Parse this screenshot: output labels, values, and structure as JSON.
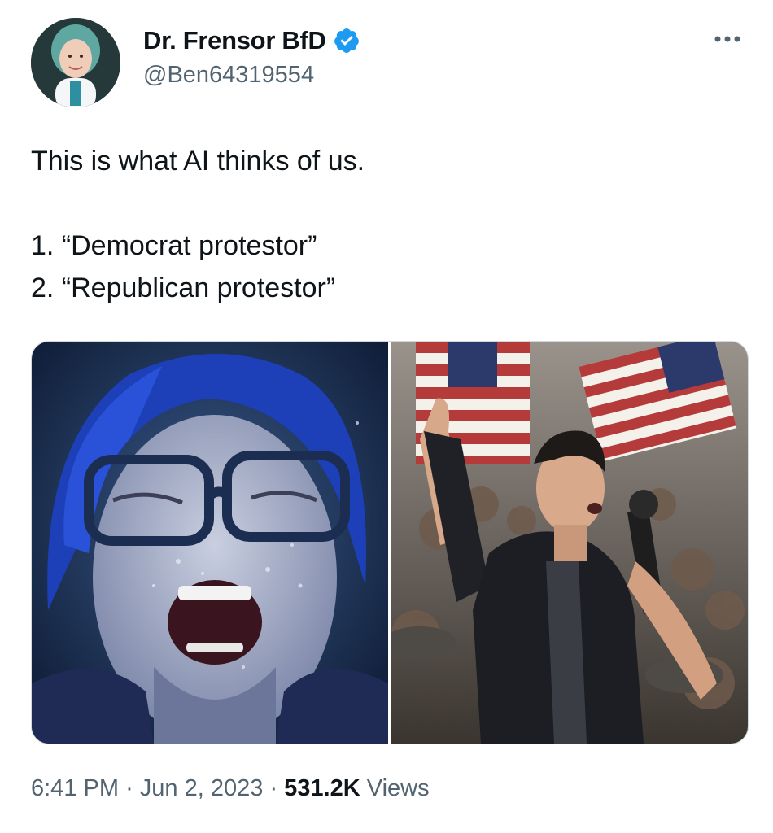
{
  "author": {
    "display_name": "Dr. Frensor BfD",
    "handle": "@Ben64319554",
    "verified": true,
    "avatar_icon": "user-avatar"
  },
  "more_icon": "more-horizontal-icon",
  "tweet": {
    "lines": [
      "This is what AI thinks of us.",
      "",
      "1. “Democrat protestor”",
      "2. “Republican protestor”"
    ]
  },
  "media": [
    {
      "description_icon": "ai-image-crying-blue-haired-woman"
    },
    {
      "description_icon": "ai-image-man-raising-fist-with-flags"
    }
  ],
  "meta": {
    "time": "6:41 PM",
    "separator": "·",
    "date": "Jun 2, 2023",
    "views_count": "531.2K",
    "views_label": "Views"
  },
  "colors": {
    "verified_blue": "#1d9bf0",
    "secondary_text": "#536471",
    "primary_text": "#0f1419"
  }
}
